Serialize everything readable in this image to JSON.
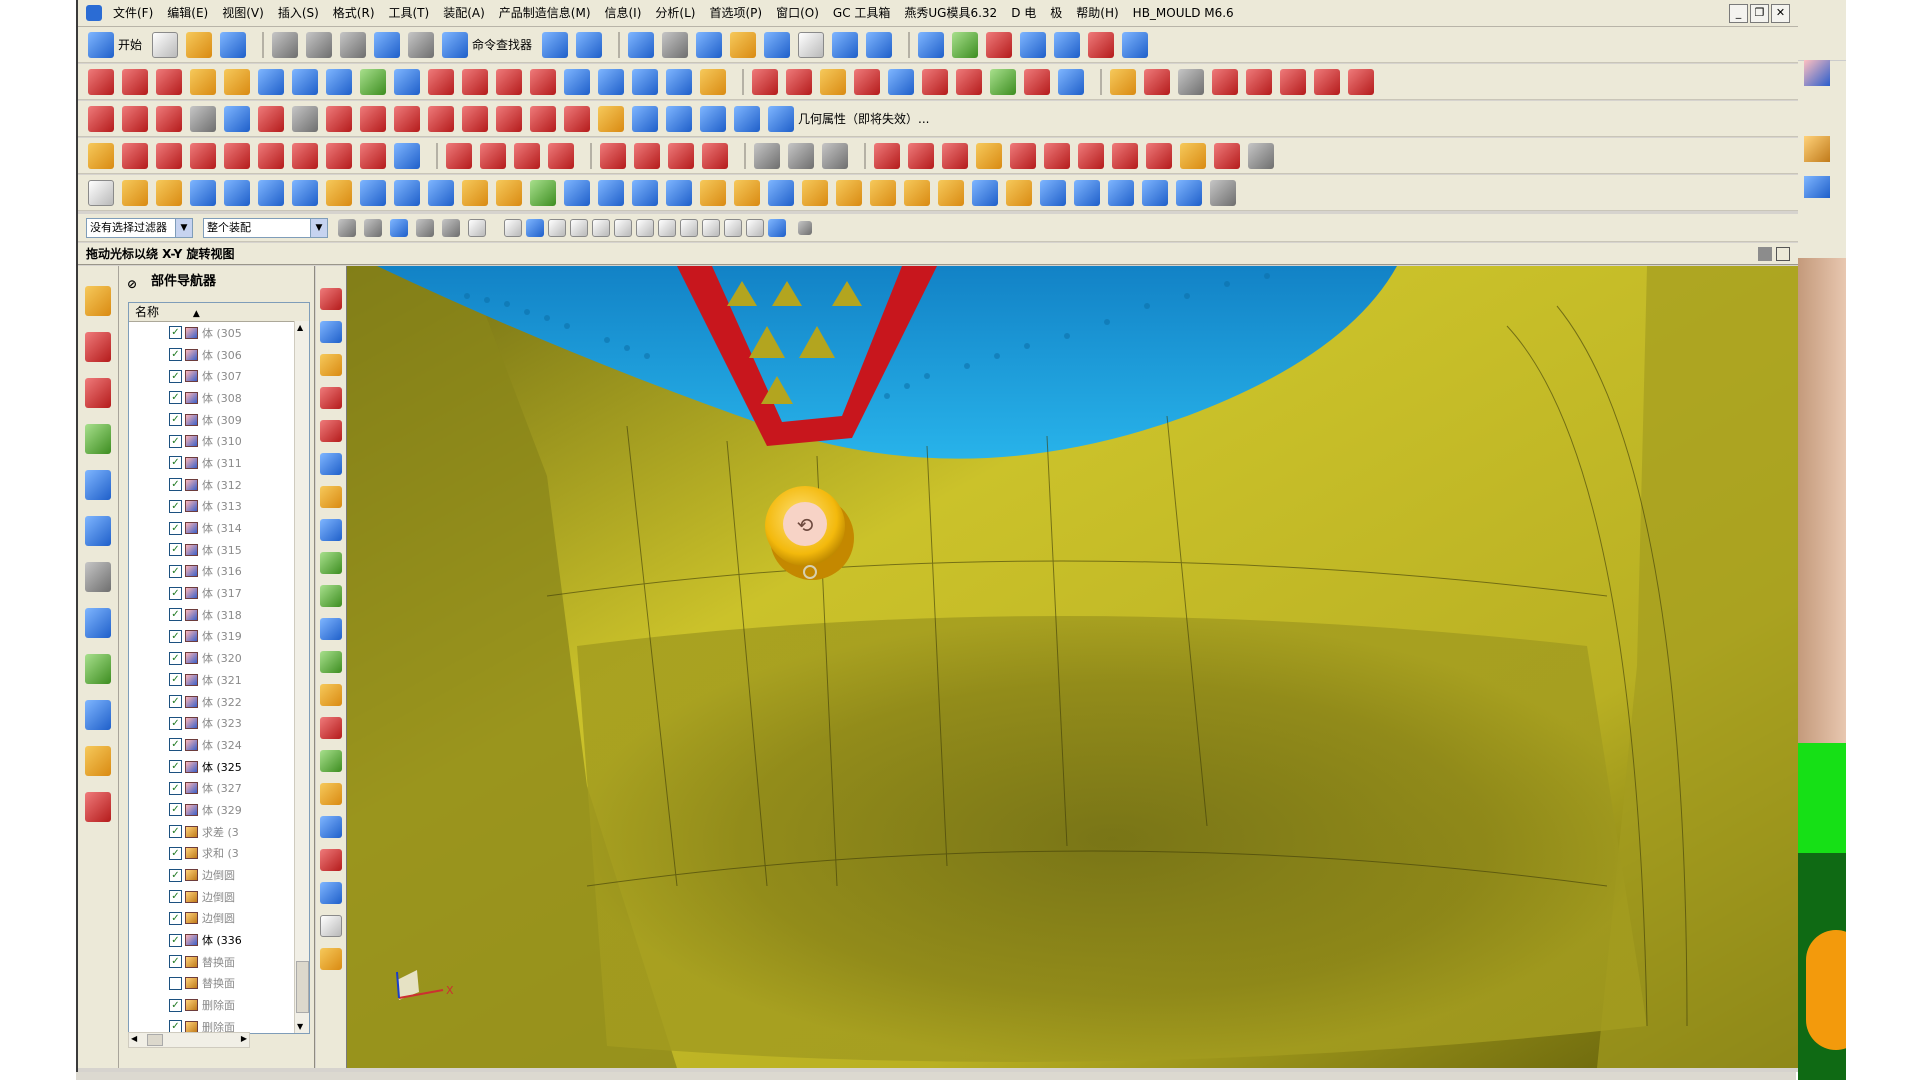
{
  "menu": {
    "items": [
      "文件(F)",
      "编辑(E)",
      "视图(V)",
      "插入(S)",
      "格式(R)",
      "工具(T)",
      "装配(A)",
      "产品制造信息(M)",
      "信息(I)",
      "分析(L)",
      "首选项(P)",
      "窗口(O)",
      "GC 工具箱",
      "燕秀UG模具6.32",
      "D 电",
      "极",
      "帮助(H)",
      "HB_MOULD M6.6"
    ]
  },
  "toolbar": {
    "start_label": "开始",
    "command_finder_label": "命令查找器",
    "geometry_property_label": "几何属性（即将失效）..."
  },
  "filter": {
    "selection_filter": "没有选择过滤器",
    "assembly_scope": "整个装配"
  },
  "status": {
    "message": "拖动光标以绕 X-Y 旋转视图"
  },
  "navigator": {
    "title": "部件导航器",
    "column_name": "名称",
    "rows": [
      {
        "label": "体 (305",
        "icon": "body-icon",
        "checked": true,
        "active": false
      },
      {
        "label": "体 (306",
        "icon": "body-icon",
        "checked": true,
        "active": false
      },
      {
        "label": "体 (307",
        "icon": "body-icon",
        "checked": true,
        "active": false
      },
      {
        "label": "体 (308",
        "icon": "body-icon",
        "checked": true,
        "active": false
      },
      {
        "label": "体 (309",
        "icon": "body-icon",
        "checked": true,
        "active": false
      },
      {
        "label": "体 (310",
        "icon": "body-icon",
        "checked": true,
        "active": false
      },
      {
        "label": "体 (311",
        "icon": "body-icon",
        "checked": true,
        "active": false
      },
      {
        "label": "体 (312",
        "icon": "body-icon",
        "checked": true,
        "active": false
      },
      {
        "label": "体 (313",
        "icon": "body-icon",
        "checked": true,
        "active": false
      },
      {
        "label": "体 (314",
        "icon": "body-icon",
        "checked": true,
        "active": false
      },
      {
        "label": "体 (315",
        "icon": "body-icon",
        "checked": true,
        "active": false
      },
      {
        "label": "体 (316",
        "icon": "body-icon",
        "checked": true,
        "active": false
      },
      {
        "label": "体 (317",
        "icon": "body-icon",
        "checked": true,
        "active": false
      },
      {
        "label": "体 (318",
        "icon": "body-icon",
        "checked": true,
        "active": false
      },
      {
        "label": "体 (319",
        "icon": "body-icon",
        "checked": true,
        "active": false
      },
      {
        "label": "体 (320",
        "icon": "body-icon",
        "checked": true,
        "active": false
      },
      {
        "label": "体 (321",
        "icon": "body-icon",
        "checked": true,
        "active": false
      },
      {
        "label": "体 (322",
        "icon": "body-icon",
        "checked": true,
        "active": false
      },
      {
        "label": "体 (323",
        "icon": "body-icon",
        "checked": true,
        "active": false
      },
      {
        "label": "体 (324",
        "icon": "body-icon",
        "checked": true,
        "active": false
      },
      {
        "label": "体 (325",
        "icon": "body-icon",
        "checked": true,
        "active": true
      },
      {
        "label": "体 (327",
        "icon": "body-icon",
        "checked": true,
        "active": false
      },
      {
        "label": "体 (329",
        "icon": "body-icon",
        "checked": true,
        "active": false
      },
      {
        "label": "求差 (3",
        "icon": "subtract-icon",
        "checked": true,
        "active": false
      },
      {
        "label": "求和 (3",
        "icon": "unite-icon",
        "checked": true,
        "active": false
      },
      {
        "label": "边倒圆",
        "icon": "edge-blend-icon",
        "checked": true,
        "active": false
      },
      {
        "label": "边倒圆",
        "icon": "edge-blend-icon",
        "checked": true,
        "active": false
      },
      {
        "label": "边倒圆",
        "icon": "edge-blend-icon",
        "checked": true,
        "active": false
      },
      {
        "label": "体 (336",
        "icon": "body-icon",
        "checked": true,
        "active": true
      },
      {
        "label": "替换面",
        "icon": "replace-face-icon",
        "checked": true,
        "active": false
      },
      {
        "label": "替换面",
        "icon": "replace-face-icon",
        "checked": false,
        "active": false
      },
      {
        "label": "删除面",
        "icon": "delete-face-icon",
        "checked": true,
        "active": false
      },
      {
        "label": "删除面",
        "icon": "delete-face-icon",
        "checked": true,
        "active": false
      }
    ]
  },
  "colors": {
    "model_yellow": "#c9c12a",
    "model_blue": "#1fa3dc",
    "model_red": "#c8161d",
    "cursor_orange": "#f2b70c"
  },
  "icons": {
    "rotate_cursor": "rotate-view-icon",
    "triad": "wcs-triad-icon"
  }
}
